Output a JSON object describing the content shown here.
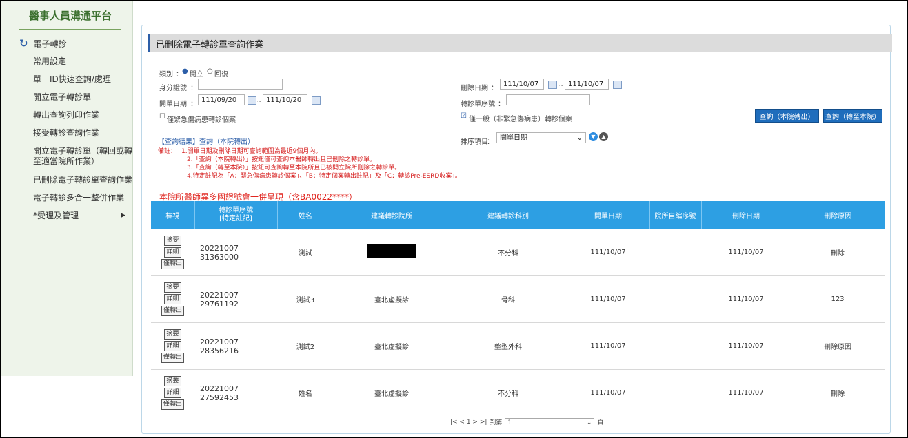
{
  "sidebar": {
    "brand": "醫事人員溝通平台",
    "section": "電子轉診",
    "items": [
      {
        "label": "常用設定"
      },
      {
        "label": "單一ID快速查詢/處理"
      },
      {
        "label": "開立電子轉診單"
      },
      {
        "label": "轉出查詢列印作業"
      },
      {
        "label": "接受轉診查詢作業"
      },
      {
        "label": "開立電子轉診單（轉回或轉至適當院所作業）"
      },
      {
        "label": "已刪除電子轉診單查詢作業"
      },
      {
        "label": "電子轉診多合一整併作業"
      },
      {
        "label": "*受理及管理"
      }
    ]
  },
  "page": {
    "title": "已刪除電子轉診單查詢作業"
  },
  "form": {
    "category_label": "類別",
    "radio_open": "開立",
    "radio_reply": "回復",
    "id_label": "身分證號",
    "open_date_label": "開單日期",
    "open_date_from": "111/09/20",
    "open_date_to": "111/10/20",
    "delete_date_label": "刪除日期",
    "delete_date_from": "111/10/07",
    "delete_date_to": "111/10/07",
    "referral_no_label": "轉診單序號",
    "only_emergency": "僅緊急傷病患轉診個案",
    "only_general": "僅一般（非緊急傷病患）轉診個案",
    "query_out_button": "查詢（本院轉出）",
    "query_in_button": "查詢（轉至本院）",
    "tilde": "~",
    "colon": "："
  },
  "result": {
    "heading": "【查詢結果】查詢（本院轉出）",
    "sort_label": "排序項目",
    "sort_value": "開單日期"
  },
  "notes": {
    "prefix": "備註：",
    "lines": [
      "1.開單日期及刪除日期可查詢範圍為最近9個月內。",
      "2.「查詢（本院轉出）」按鈕僅可查詢本醫師轉出且已刪除之轉診單。",
      "3.「查詢（轉至本院）」按鈕可查詢轉至本院所且已被開立院所刪除之轉診單。",
      "4.特定註記為「A：緊急傷病患轉診個案」、「B：特定個案轉出註記」及「C：轉診Pre-ESRD收案」。"
    ]
  },
  "announcement": "本院所醫師異多國證號會一併呈現（含BA0022****）",
  "table": {
    "headers": [
      "檢視",
      "轉診單序號\n[特定註記]",
      "姓名",
      "建議轉診院所",
      "建議轉診科別",
      "開單日期",
      "院所自編序號",
      "刪除日期",
      "刪除原因"
    ],
    "actions": [
      "摘要",
      "詳細",
      "僅轉出"
    ],
    "rows": [
      {
        "serial": "20221007\n31363000",
        "name": "測試",
        "hospital": "",
        "dept": "不分科",
        "open_date": "111/10/07",
        "own_no": "",
        "delete_date": "111/10/07",
        "reason": "刪除",
        "redacted": true
      },
      {
        "serial": "20221007\n29761192",
        "name": "測試3",
        "hospital": "臺北虛擬診",
        "dept": "骨科",
        "open_date": "111/10/07",
        "own_no": "",
        "delete_date": "111/10/07",
        "reason": "123",
        "redacted": false
      },
      {
        "serial": "20221007\n28356216",
        "name": "測試2",
        "hospital": "臺北虛擬診",
        "dept": "整型外科",
        "open_date": "111/10/07",
        "own_no": "",
        "delete_date": "111/10/07",
        "reason": "刪除原因",
        "redacted": false
      },
      {
        "serial": "20221007\n27592453",
        "name": "姓名",
        "hospital": "臺北虛擬診",
        "dept": "不分科",
        "open_date": "111/10/07",
        "own_no": "",
        "delete_date": "111/10/07",
        "reason": "刪除",
        "redacted": false
      }
    ]
  },
  "pager": {
    "nav": "|< < 1 > >|",
    "goto_label": "到第",
    "page_value": "1",
    "page_suffix": "頁"
  }
}
